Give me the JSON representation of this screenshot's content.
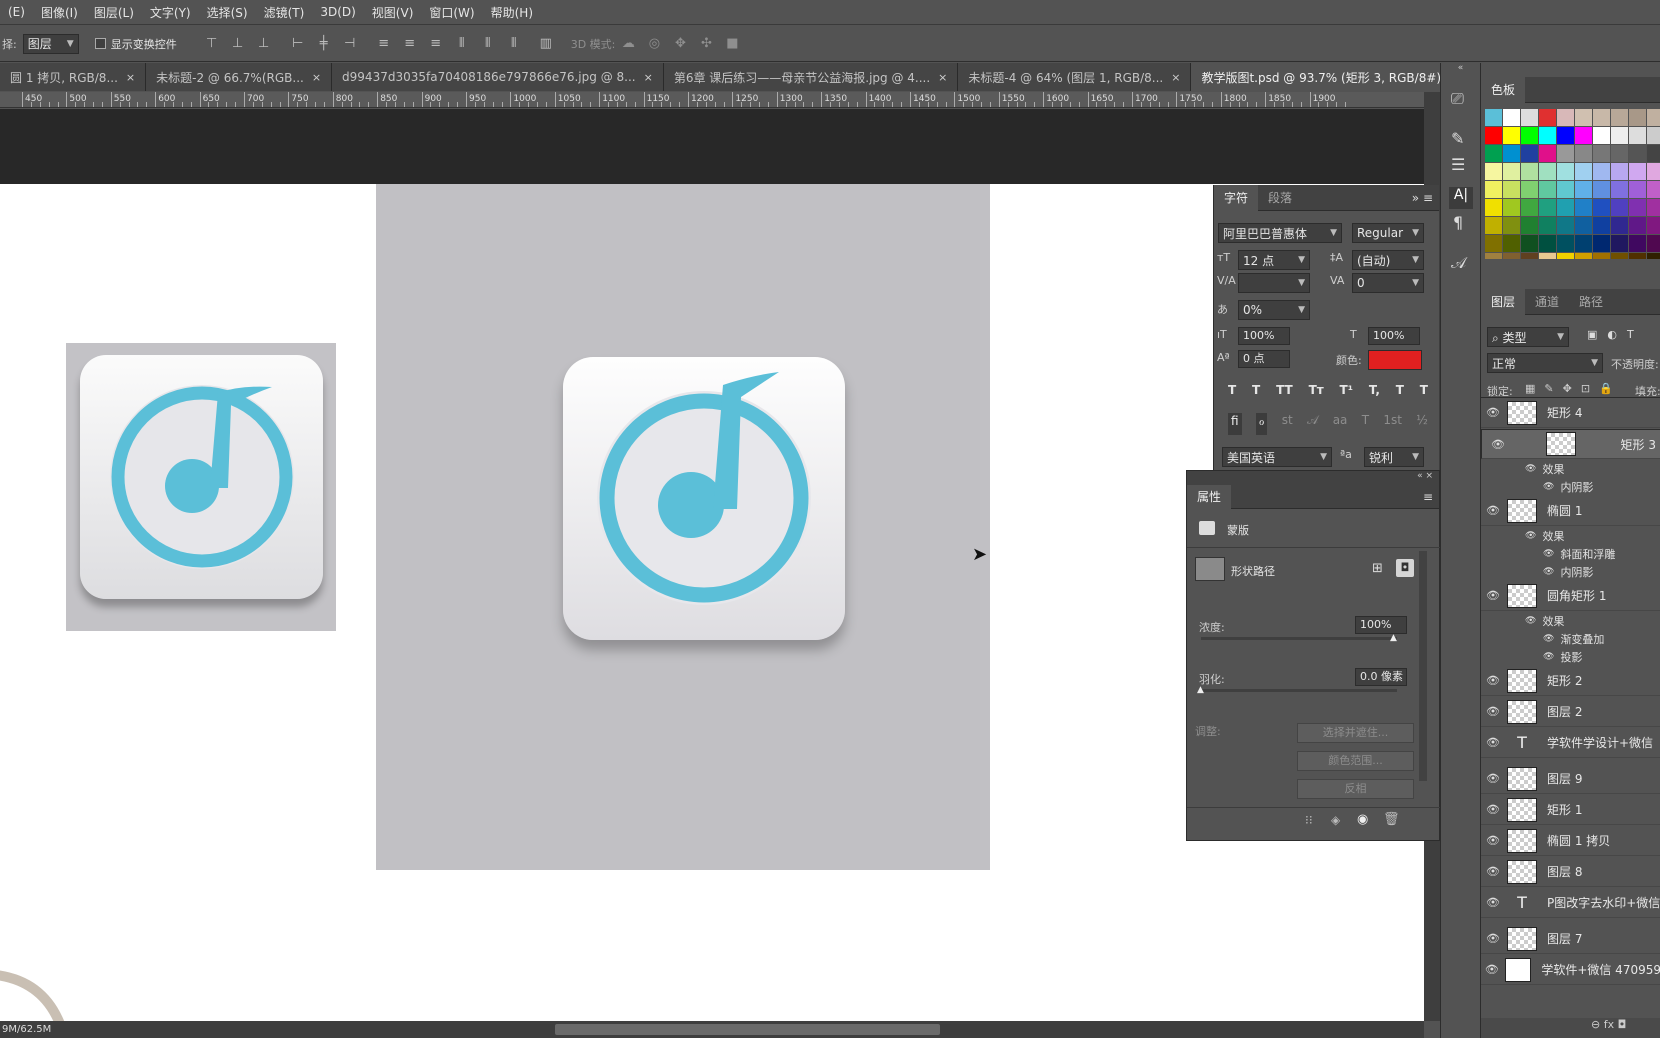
{
  "menu": [
    "(E)",
    "图像(I)",
    "图层(L)",
    "文字(Y)",
    "选择(S)",
    "滤镜(T)",
    "3D(D)",
    "视图(V)",
    "窗口(W)",
    "帮助(H)"
  ],
  "options": {
    "select_label": "择:",
    "layer_select": "图层",
    "show_transform": "显示变换控件",
    "mode3d": "3D 模式:"
  },
  "tabs": [
    {
      "label": "圆 1 拷贝, RGB/8...",
      "close": "×"
    },
    {
      "label": "未标题-2 @ 66.7%(RGB...",
      "close": "×"
    },
    {
      "label": "d99437d3035fa70408186e797866e76.jpg @ 8...",
      "close": "×"
    },
    {
      "label": "第6章 课后练习——母亲节公益海报.jpg @ 4....",
      "close": "×"
    },
    {
      "label": "未标题-4 @ 64% (图层 1, RGB/8...",
      "close": "×"
    },
    {
      "label": "教学版图t.psd @ 93.7% (矩形 3, RGB/8#) *",
      "close": "×"
    }
  ],
  "ruler": [
    "450",
    "500",
    "550",
    "600",
    "650",
    "700",
    "750",
    "800",
    "850",
    "900",
    "950",
    "1000",
    "1050",
    "1100",
    "1150",
    "1200",
    "1250",
    "1300",
    "1350",
    "1400",
    "1450",
    "1500",
    "1550",
    "1600",
    "1650",
    "1700",
    "1750",
    "1800",
    "1850",
    "1900"
  ],
  "status": "9M/62.5M",
  "character": {
    "tabs": [
      "字符",
      "段落"
    ],
    "font_family": "阿里巴巴普惠体",
    "font_style": "Regular",
    "size": "12 点",
    "leading": "(自动)",
    "kerning": "",
    "tracking": "0",
    "tsume": "0%",
    "vscale": "100%",
    "hscale": "100%",
    "baseline": "0 点",
    "color_label": "颜色:",
    "color": "#e02020",
    "language": "美国英语",
    "aa_icon": "ªa",
    "antialias": "锐利",
    "style_buttons": [
      "T",
      "T",
      "TT",
      "Tт",
      "T¹",
      "T,",
      "T",
      "T"
    ],
    "ot_buttons": [
      "fi",
      "ℴ",
      "st",
      "𝒜",
      "aa",
      "T",
      "1st",
      "½"
    ]
  },
  "properties": {
    "title": "属性",
    "mask_label": "蒙版",
    "shape_path": "形状路径",
    "density_label": "浓度:",
    "density": "100%",
    "feather_label": "羽化:",
    "feather": "0.0 像素",
    "adjust_label": "调整:",
    "btn_select": "选择并遮住...",
    "btn_color": "颜色范围...",
    "btn_invert": "反相"
  },
  "swatches": {
    "title": "色板"
  },
  "layers_panel": {
    "tabs": [
      "图层",
      "通道",
      "路径"
    ],
    "filter": "类型",
    "blend": "正常",
    "opacity_label": "不透明度:",
    "lock_label": "锁定:",
    "fill_label": "填充:",
    "layers": [
      {
        "name": "矩形 4",
        "type": "shape"
      },
      {
        "name": "矩形 3",
        "type": "shape",
        "selected": true
      },
      {
        "fx": "效果"
      },
      {
        "fx": "内阴影",
        "sub": true
      },
      {
        "name": "椭圆 1",
        "type": "shape"
      },
      {
        "fx": "效果"
      },
      {
        "fx": "斜面和浮雕",
        "sub": true
      },
      {
        "fx": "内阴影",
        "sub": true
      },
      {
        "name": "圆角矩形 1",
        "type": "shape"
      },
      {
        "fx": "效果"
      },
      {
        "fx": "渐变叠加",
        "sub": true
      },
      {
        "fx": "投影",
        "sub": true
      },
      {
        "name": "矩形 2",
        "type": "shape"
      },
      {
        "name": "图层 2",
        "type": "pixel"
      },
      {
        "name": "学软件学设计+微信",
        "type": "text"
      },
      {
        "name": "图层 9",
        "type": "pixel"
      },
      {
        "name": "矩形 1",
        "type": "shape"
      },
      {
        "name": "椭圆 1 拷贝",
        "type": "shape"
      },
      {
        "name": "图层 8",
        "type": "pixel"
      },
      {
        "name": "P图改字去水印+微信",
        "type": "text"
      },
      {
        "name": "图层 7",
        "type": "pixel"
      },
      {
        "name": "学软件+微信 470959",
        "type": "white"
      }
    ]
  },
  "colors": {
    "accent": "#5bbfd8",
    "panel": "#535353",
    "canvas_gray": "#c1c0c4"
  }
}
